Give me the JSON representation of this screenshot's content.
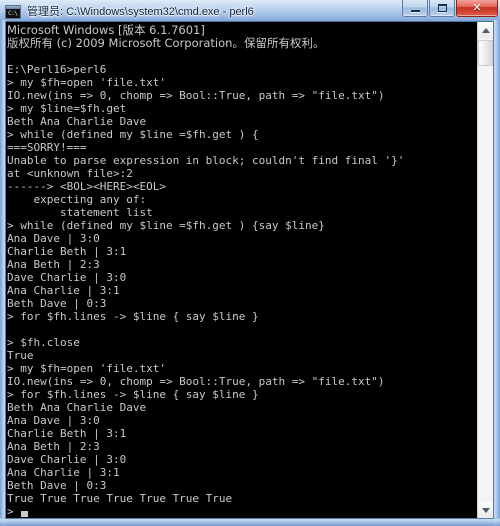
{
  "window": {
    "title": "管理员: C:\\Windows\\system32\\cmd.exe - perl6",
    "icon_name": "cmd-console-icon",
    "icon_prompt_text": "C:\\",
    "background_color": "#000000",
    "text_color": "#c8c8c8"
  },
  "caption_buttons": {
    "minimize_label": "—",
    "maximize_label": "❐",
    "close_label": "✕"
  },
  "scrollbar": {
    "up_arrow_label": "▲",
    "down_arrow_label": "▼"
  },
  "console": {
    "prompt_symbol": ">",
    "cursor": "█",
    "lines": [
      "Microsoft Windows [版本 6.1.7601]",
      "版权所有 (c) 2009 Microsoft Corporation。保留所有权利。",
      "",
      "E:\\Perl16>perl6",
      "> my $fh=open 'file.txt'",
      "IO.new(ins => 0, chomp => Bool::True, path => \"file.txt\")",
      "> my $line=$fh.get",
      "Beth Ana Charlie Dave",
      "> while (defined my $line =$fh.get ) {",
      "===SORRY!===",
      "Unable to parse expression in block; couldn't find final '}'",
      "at <unknown file>:2",
      "------> <BOL><HERE><EOL>",
      "    expecting any of:",
      "        statement list",
      "> while (defined my $line =$fh.get ) {say $line}",
      "Ana Dave | 3:0",
      "Charlie Beth | 3:1",
      "Ana Beth | 2:3",
      "Dave Charlie | 3:0",
      "Ana Charlie | 3:1",
      "Beth Dave | 0:3",
      "> for $fh.lines -> $line { say $line }",
      "",
      "> $fh.close",
      "True",
      "> my $fh=open 'file.txt'",
      "IO.new(ins => 0, chomp => Bool::True, path => \"file.txt\")",
      "> for $fh.lines -> $line { say $line }",
      "Beth Ana Charlie Dave",
      "Ana Dave | 3:0",
      "Charlie Beth | 3:1",
      "Ana Beth | 2:3",
      "Dave Charlie | 3:0",
      "Ana Charlie | 3:1",
      "Beth Dave | 0:3",
      "True True True True True True True"
    ]
  }
}
